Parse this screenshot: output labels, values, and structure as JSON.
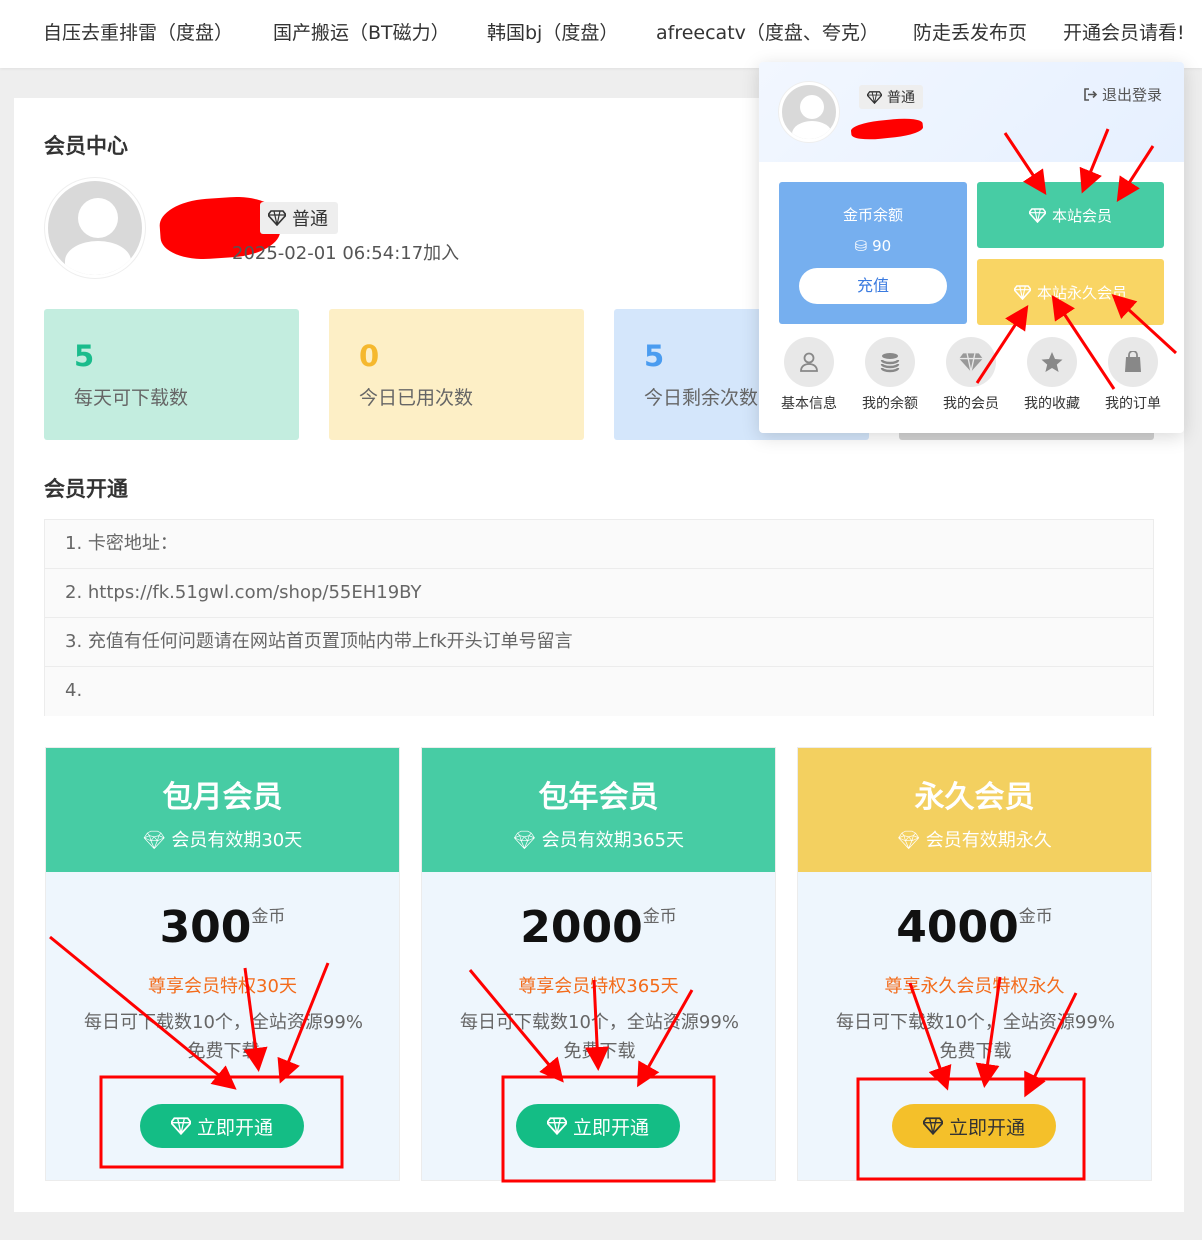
{
  "nav": {
    "items": [
      "自压去重排雷（度盘）",
      "国产搬运（BT磁力）",
      "韩国bj（度盘）",
      "afreecatv（度盘、夸克）",
      "防走丢发布页",
      "开通会员请看!"
    ]
  },
  "member_center": {
    "title": "会员中心",
    "level": "普通",
    "joined": "2025-02-01 06:54:17加入"
  },
  "stats": [
    {
      "value": "5",
      "label": "每天可下载数"
    },
    {
      "value": "0",
      "label": "今日已用次数"
    },
    {
      "value": "5",
      "label": "今日剩余次数"
    }
  ],
  "opening": {
    "title": "会员开通",
    "notices": [
      "1. 卡密地址：",
      "2. https://fk.51gwl.com/shop/55EH19BY",
      "3. 充值有任何问题请在网站首页置顶帖内带上fk开头订单号留言",
      "4."
    ]
  },
  "plans": [
    {
      "name": "包月会员",
      "duration": "会员有效期30天",
      "price": "300",
      "unit": "金币",
      "privilege": "尊享会员特权30天",
      "desc": "每日可下载数10个，全站资源99%免费下载",
      "button": "立即开通",
      "color": "#47cca4",
      "btn_color": "#14bd85",
      "btn_text": "#ffffff"
    },
    {
      "name": "包年会员",
      "duration": "会员有效期365天",
      "price": "2000",
      "unit": "金币",
      "privilege": "尊享会员特权365天",
      "desc": "每日可下载数10个，全站资源99%免费下载",
      "button": "立即开通",
      "color": "#47cca4",
      "btn_color": "#14bd85",
      "btn_text": "#ffffff"
    },
    {
      "name": "永久会员",
      "duration": "会员有效期永久",
      "price": "4000",
      "unit": "金币",
      "privilege": "尊享永久会员特权永久",
      "desc": "每日可下载数10个，全站资源99%免费下载",
      "button": "立即开通",
      "color": "#f3d060",
      "btn_color": "#f4c02a",
      "btn_text": "#333333"
    }
  ],
  "dropdown": {
    "level": "普通",
    "logout": "退出登录",
    "coin_title": "金币余额",
    "coin_value": "90",
    "recharge": "充值",
    "site_member": "本站会员",
    "site_permanent": "本站永久会员",
    "links": [
      "基本信息",
      "我的余额",
      "我的会员",
      "我的收藏",
      "我的订单"
    ]
  },
  "colors": {
    "stat_bg": [
      "#c3eddf",
      "#fdefc6",
      "#d4e6fb"
    ],
    "stat_num": [
      "#1abc8c",
      "#f5b82e",
      "#4a9cf0"
    ],
    "accent_green": "#47cca4",
    "accent_yellow": "#f9d564",
    "coin_blue": "#76afef",
    "annotation_red": "#ff0000"
  }
}
